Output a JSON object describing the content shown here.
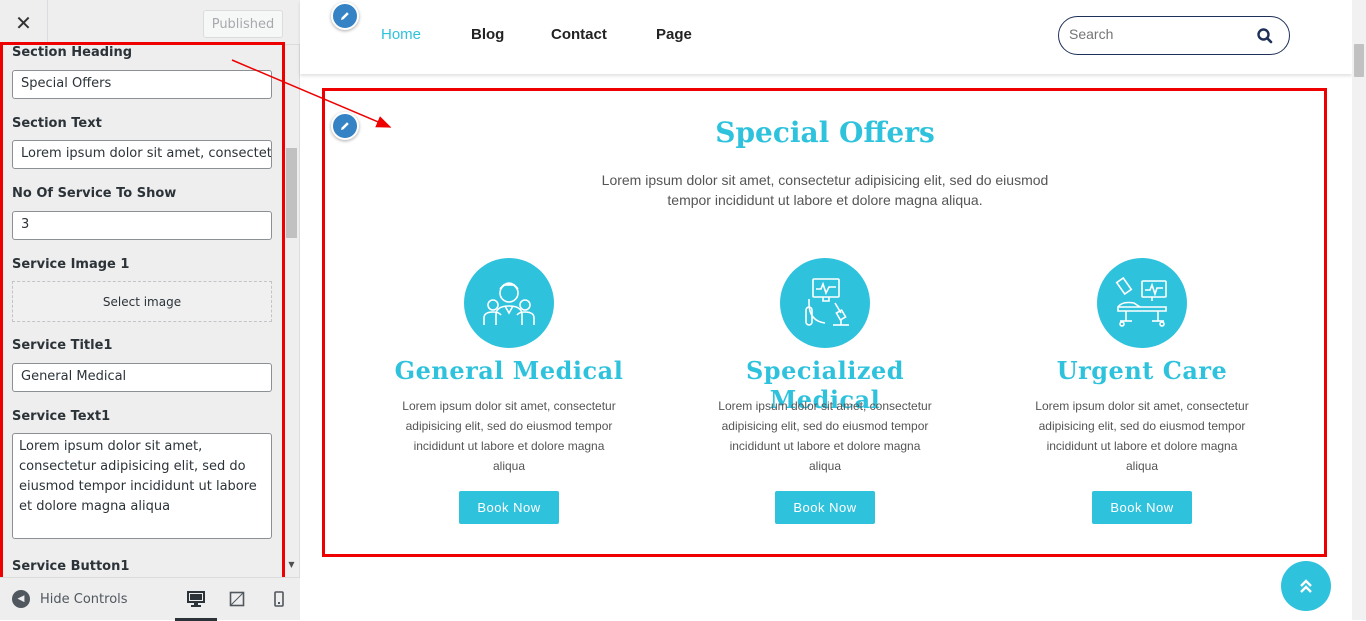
{
  "customizer": {
    "close_icon": "close-icon",
    "published_label": "Published",
    "controls": {
      "section_heading_label": "Section Heading",
      "section_heading_value": "Special Offers",
      "section_text_label": "Section Text",
      "section_text_value": "Lorem ipsum dolor sit amet, consectetur",
      "num_services_label": "No Of Service To Show",
      "num_services_value": "3",
      "service_image1_label": "Service Image 1",
      "select_image_label": "Select image",
      "service_title1_label": "Service Title1",
      "service_title1_value": "General Medical",
      "service_text1_label": "Service Text1",
      "service_text1_value": "Lorem ipsum dolor sit amet, consectetur adipisicing elit, sed do eiusmod tempor incididunt ut labore et dolore magna aliqua",
      "service_button1_label": "Service Button1"
    },
    "footer": {
      "hide_controls_label": "Hide Controls",
      "devices": [
        "desktop-icon",
        "tablet-icon",
        "mobile-icon"
      ]
    }
  },
  "site": {
    "nav": {
      "home": "Home",
      "blog": "Blog",
      "contact": "Contact",
      "page": "Page"
    },
    "search": {
      "placeholder": "Search"
    },
    "offers": {
      "heading": "Special Offers",
      "text": "Lorem ipsum dolor sit amet, consectetur adipisicing elit, sed do eiusmod tempor incididunt ut labore et dolore magna aliqua.",
      "cards": [
        {
          "icon": "nurse-team-icon",
          "title": "General Medical",
          "text": "Lorem ipsum dolor sit amet, consectetur adipisicing elit, sed do eiusmod tempor incididunt ut labore et dolore magna aliqua",
          "button": "Book Now"
        },
        {
          "icon": "lab-monitor-icon",
          "title": "Specialized Medical",
          "text": "Lorem ipsum dolor sit amet, consectetur adipisicing elit, sed do eiusmod tempor incididunt ut labore et dolore magna aliqua",
          "button": "Book Now"
        },
        {
          "icon": "hospital-bed-icon",
          "title": "Urgent Care",
          "text": "Lorem ipsum dolor sit amet, consectetur adipisicing elit, sed do eiusmod tempor incididunt ut labore et dolore magna aliqua",
          "button": "Book Now"
        }
      ]
    }
  },
  "colors": {
    "accent": "#2fc2dd",
    "annotation_red": "#ee0000",
    "edit_blue": "#3582c4"
  }
}
